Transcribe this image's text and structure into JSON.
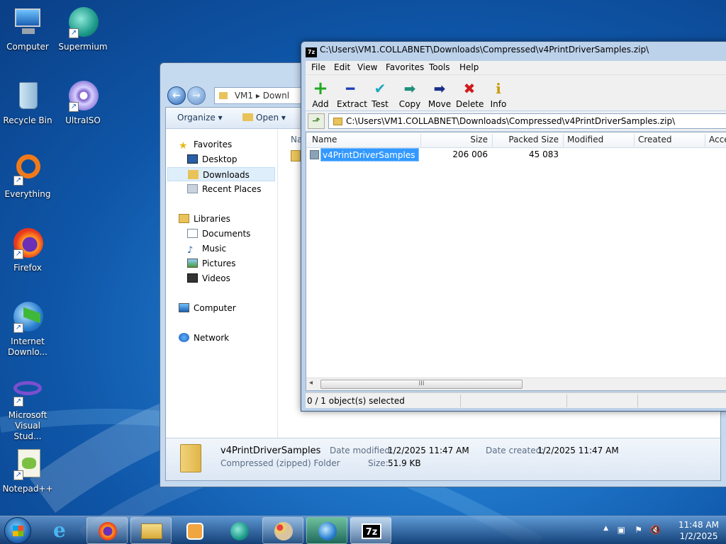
{
  "desktop": {
    "icons": [
      {
        "label": "Computer",
        "shortcut": false
      },
      {
        "label": "Supermium",
        "shortcut": true
      },
      {
        "label": "Recycle Bin",
        "shortcut": false
      },
      {
        "label": "UltraISO",
        "shortcut": true
      },
      {
        "label": "Everything",
        "shortcut": true
      },
      {
        "label": "Firefox",
        "shortcut": true
      },
      {
        "label": "Internet Downlo...",
        "shortcut": true
      },
      {
        "label": "Microsoft Visual Stud...",
        "shortcut": true
      },
      {
        "label": "Notepad++",
        "shortcut": true
      }
    ]
  },
  "explorer": {
    "breadcrumb": [
      "VM1",
      "Downl"
    ],
    "toolbar": {
      "organize": "Organize",
      "open": "Open"
    },
    "column_name": "Na",
    "nav": {
      "favorites": "Favorites",
      "desktop": "Desktop",
      "downloads": "Downloads",
      "recent": "Recent Places",
      "libraries": "Libraries",
      "documents": "Documents",
      "music": "Music",
      "pictures": "Pictures",
      "videos": "Videos",
      "computer": "Computer",
      "network": "Network"
    },
    "details": {
      "name": "v4PrintDriverSamples",
      "type": "Compressed (zipped) Folder",
      "modified_label": "Date modified:",
      "modified": "1/2/2025 11:47 AM",
      "created_label": "Date created:",
      "created": "1/2/2025 11:47 AM",
      "size_label": "Size:",
      "size": "51.9 KB"
    }
  },
  "sevenzip": {
    "title": "C:\\Users\\VM1.COLLABNET\\Downloads\\Compressed\\v4PrintDriverSamples.zip\\",
    "logo": "7z",
    "menu": [
      "File",
      "Edit",
      "View",
      "Favorites",
      "Tools",
      "Help"
    ],
    "toolbar": [
      {
        "label": "Add",
        "icon": "add-icon",
        "glyph": "+",
        "color": "#22a822"
      },
      {
        "label": "Extract",
        "icon": "extract-icon",
        "glyph": "━",
        "color": "#1c3fb8"
      },
      {
        "label": "Test",
        "icon": "test-icon",
        "glyph": "✔",
        "color": "#1ea7c0"
      },
      {
        "label": "Copy",
        "icon": "copy-icon",
        "glyph": "➡",
        "color": "#1f8f7a"
      },
      {
        "label": "Move",
        "icon": "move-icon",
        "glyph": "➡",
        "color": "#1a2f8a"
      },
      {
        "label": "Delete",
        "icon": "delete-icon",
        "glyph": "✖",
        "color": "#d11a1a"
      },
      {
        "label": "Info",
        "icon": "info-icon",
        "glyph": "i",
        "color": "#c99a00"
      }
    ],
    "path": "C:\\Users\\VM1.COLLABNET\\Downloads\\Compressed\\v4PrintDriverSamples.zip\\",
    "columns": [
      "Name",
      "Size",
      "Packed Size",
      "Modified",
      "Created",
      "Acce"
    ],
    "rows": [
      {
        "name": "v4PrintDriverSamples",
        "size": "206 006",
        "packed": "45 083"
      }
    ],
    "scroll_grip": "III",
    "status": "0 / 1 object(s) selected"
  },
  "taskbar": {
    "time": "11:48 AM",
    "date": "1/2/2025",
    "active_label": "7z"
  }
}
